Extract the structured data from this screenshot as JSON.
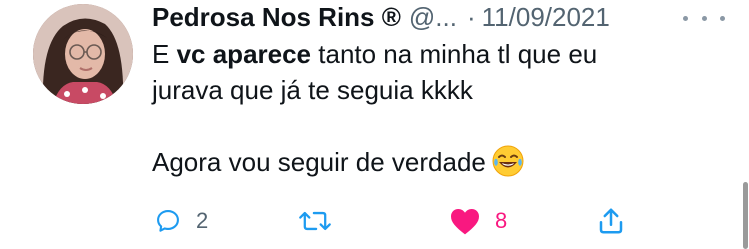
{
  "tweet": {
    "display_name": "Pedrosa Nos Rins ®",
    "handle": "@...",
    "separator": "·",
    "date": "11/09/2021",
    "text": {
      "line1_prefix": "E ",
      "line1_bold": "vc aparece",
      "line1_suffix": " tanto na minha tl que eu",
      "line2": "jurava que já te seguia kkkk",
      "line3": "Agora vou seguir de verdade"
    },
    "actions": {
      "reply_count": "2",
      "like_count": "8"
    }
  },
  "colors": {
    "text_primary": "#0f1419",
    "text_secondary": "#536471",
    "like": "#f91880",
    "icon": "#1d9bf0"
  },
  "icons": {
    "reply": "reply-icon",
    "retweet": "retweet-icon",
    "like": "heart-icon",
    "share": "share-icon",
    "more": "more-icon",
    "emoji": "laughing-emoji"
  }
}
